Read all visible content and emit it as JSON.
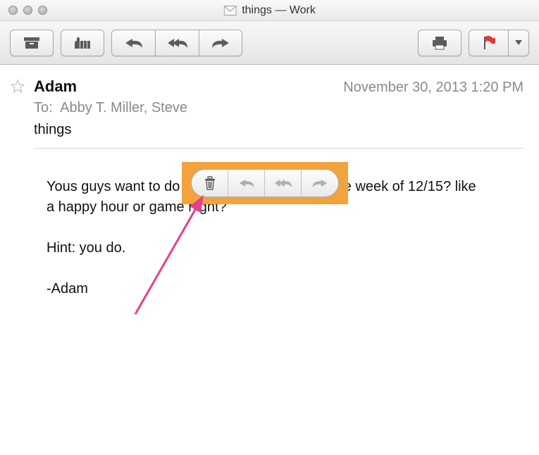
{
  "window": {
    "title": "things — Work"
  },
  "toolbar": {
    "archive": "Archive",
    "junk": "Junk",
    "reply": "Reply",
    "reply_all": "Reply All",
    "forward": "Forward",
    "print": "Print",
    "flag": "Flag"
  },
  "message": {
    "from": "Adam",
    "date": "November 30, 2013  1:20 PM",
    "to_label": "To:",
    "to": "Abby T. Miller,    Steve",
    "subject": "things",
    "body": "Yous guys want to do something a weeknight the week of 12/15? like a happy hour or game night?\n\nHint: you do.\n\n-Adam"
  },
  "popup": {
    "delete": "Delete",
    "reply": "Reply",
    "reply_all": "Reply All",
    "forward": "Forward"
  }
}
